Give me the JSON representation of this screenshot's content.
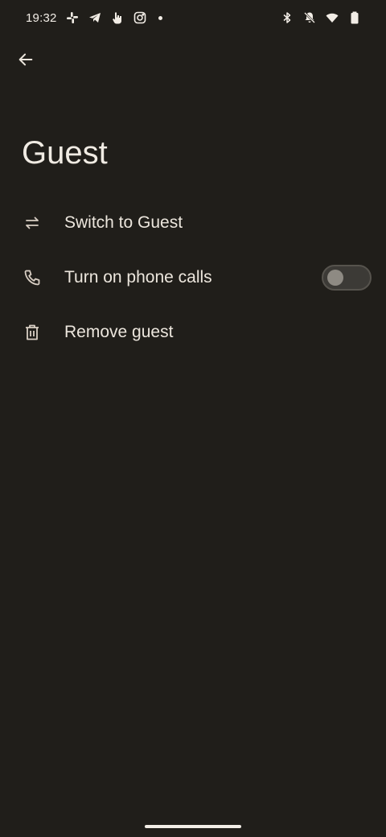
{
  "status_bar": {
    "time": "19:32",
    "left_icons": [
      "slack-icon",
      "telegram-icon",
      "hand-icon",
      "instagram-icon",
      "more-dot-icon"
    ],
    "right_icons": [
      "bluetooth-icon",
      "muted-bell-icon",
      "wifi-icon",
      "battery-icon"
    ]
  },
  "header": {
    "back_icon": "arrow-back-icon",
    "title": "Guest"
  },
  "list": {
    "items": [
      {
        "icon": "swap-icon",
        "label": "Switch to Guest"
      },
      {
        "icon": "phone-icon",
        "label": "Turn on phone calls",
        "toggle_on": false
      },
      {
        "icon": "trash-icon",
        "label": "Remove guest"
      }
    ]
  },
  "colors": {
    "background": "#201e1a",
    "text": "#ece6dd",
    "icon": "#d9cfc4"
  }
}
